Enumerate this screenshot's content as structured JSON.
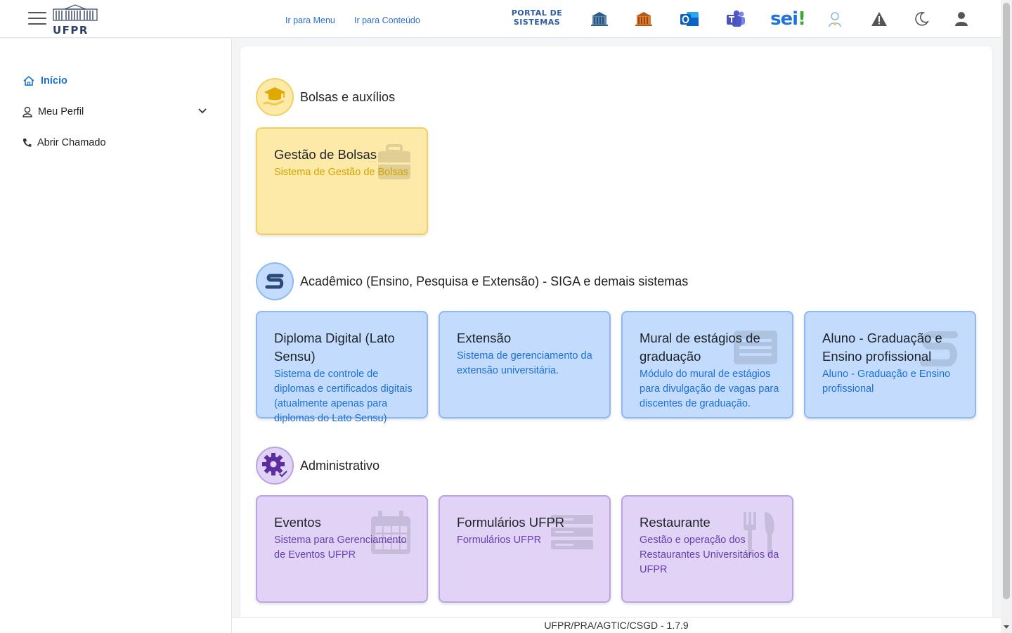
{
  "topbar": {
    "logo_text": "UFPR",
    "skip_menu": "Ir para Menu",
    "skip_content": "Ir para Conteúdo",
    "portal_line1": "PORTAL DE",
    "portal_line2": "SISTEMAS",
    "sei_text": "sei",
    "sei_mark": "!"
  },
  "sidebar": {
    "items": [
      {
        "label": "Início",
        "icon": "home-icon",
        "active": true
      },
      {
        "label": "Meu Perfil",
        "icon": "user-icon"
      },
      {
        "label": "Abrir Chamado",
        "icon": "phone-icon"
      }
    ]
  },
  "sections": [
    {
      "title": "Bolsas e auxílios",
      "color": "#f2c94c",
      "cards": [
        {
          "title": "Gestão de Bolsas",
          "desc": "Sistema de Gestão de Bolsas",
          "icon": "briefcase-icon"
        }
      ]
    },
    {
      "title": "Acadêmico (Ensino, Pesquisa e Extensão) - SIGA e demais sistemas",
      "color": "#1b6fd8",
      "cards": [
        {
          "title": "Diploma Digital (Lato Sensu)",
          "desc": "Sistema de controle de diplomas e certificados digitais (atualmente apenas para diplomas do Lato Sensu)",
          "icon": ""
        },
        {
          "title": "Extensão",
          "desc": "Sistema de gerenciamento da extensão universitária.",
          "icon": ""
        },
        {
          "title": "Mural de estágios de graduação",
          "desc": "Módulo do mural de estágios para divulgação de vagas para discentes de graduação.",
          "icon": "list-card-icon"
        },
        {
          "title": "Aluno - Graduação e Ensino profissional",
          "desc": "Aluno - Graduação e Ensino profissional",
          "icon": "siga-s-icon"
        }
      ]
    },
    {
      "title": "Administrativo",
      "color": "#6a3fb0",
      "cards": [
        {
          "title": "Eventos",
          "desc": "Sistema para Gerenciamento de Eventos UFPR",
          "icon": "calendar-icon"
        },
        {
          "title": "Formulários UFPR",
          "desc": "Formulários UFPR",
          "icon": "form-icon"
        },
        {
          "title": "Restaurante",
          "desc": "Gestão e operação dos Restaurantes Universitários da UFPR",
          "icon": "utensils-icon"
        }
      ]
    }
  ],
  "footer": {
    "text": "UFPR/PRA/AGTIC/CSGD - 1.7.9"
  }
}
